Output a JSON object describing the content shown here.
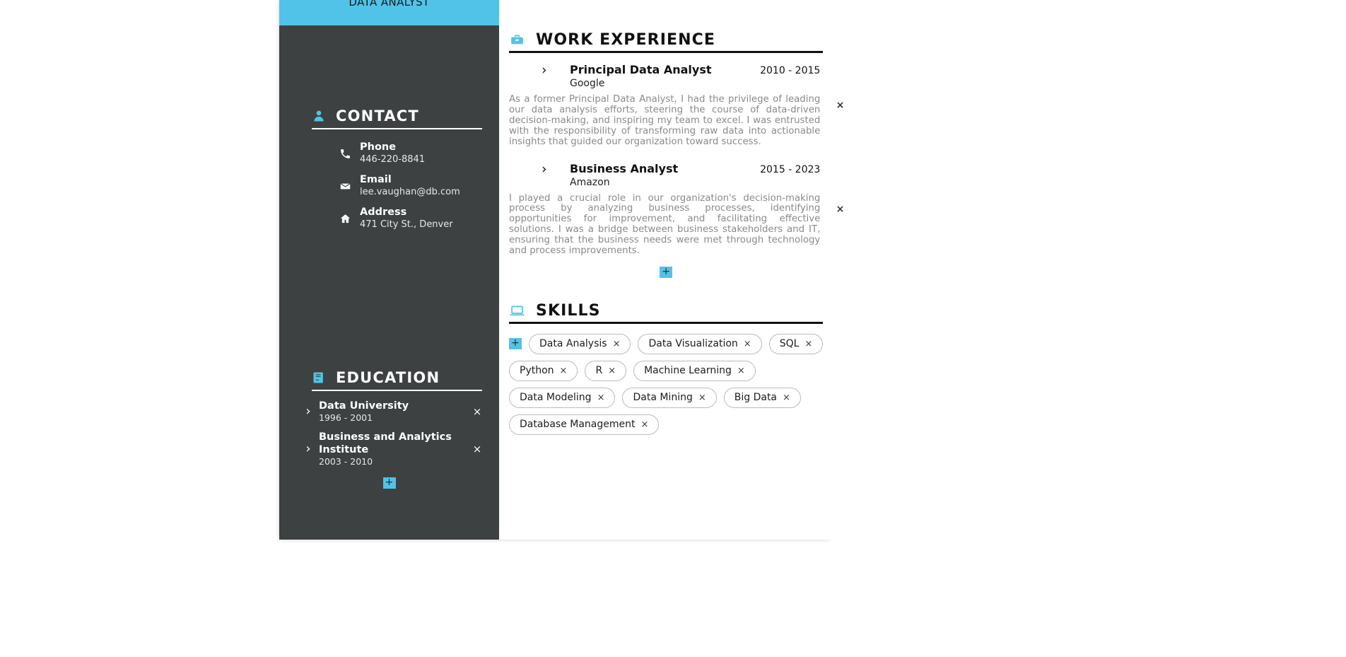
{
  "banner": {
    "title": "DATA ANALYST"
  },
  "sidebar": {
    "contact": {
      "heading": "CONTACT",
      "icon": "person-icon",
      "rows": [
        {
          "icon": "phone-icon",
          "label": "Phone",
          "value": "446-220-8841"
        },
        {
          "icon": "envelope-icon",
          "label": "Email",
          "value": "lee.vaughan@db.com"
        },
        {
          "icon": "home-icon",
          "label": "Address",
          "value": "471 City St., Denver"
        }
      ]
    },
    "education": {
      "heading": "EDUCATION",
      "icon": "book-icon",
      "entries": [
        {
          "name": "Data University",
          "dates": "1996 - 2001",
          "chevron": "›",
          "remove": "×"
        },
        {
          "name": "Business and Analytics Institute",
          "dates": "2003 - 2010",
          "chevron": "›",
          "remove": "×"
        }
      ],
      "add_label": "+"
    }
  },
  "main": {
    "work": {
      "heading": "WORK EXPERIENCE",
      "icon": "briefcase-icon",
      "jobs": [
        {
          "title": "Principal Data Analyst",
          "company": "Google",
          "dates": "2010 - 2015",
          "chevron": "›",
          "remove": "×",
          "description": "As a former Principal Data Analyst, I had the privilege of leading our data analysis efforts, steering the course of data-driven decision-making, and inspiring my team to excel. I was entrusted with the responsibility of transforming raw data into actionable insights that guided our organization toward success."
        },
        {
          "title": "Business Analyst",
          "company": "Amazon",
          "dates": "2015 - 2023",
          "chevron": "›",
          "remove": "×",
          "description": "I played a crucial role in our organization's decision-making process by analyzing business processes, identifying opportunities for improvement, and facilitating effective solutions. I was a bridge between business stakeholders and IT, ensuring that the business needs were met through technology and process improvements."
        }
      ],
      "add_label": "+"
    },
    "skills": {
      "heading": "SKILLS",
      "icon": "laptop-icon",
      "add_label": "+",
      "remove_label": "×",
      "rows": [
        [
          "Data Analysis",
          "Data Visualization",
          "SQL"
        ],
        [
          "Python",
          "R",
          "Machine Learning"
        ],
        [
          "Data Modeling",
          "Data Mining",
          "Big Data"
        ],
        [
          "Database Management"
        ]
      ]
    }
  },
  "colors": {
    "accent": "#51c3e8",
    "sidebar_bg": "#3d4141",
    "text_dark": "#111111",
    "muted": "#8a8a8a"
  }
}
